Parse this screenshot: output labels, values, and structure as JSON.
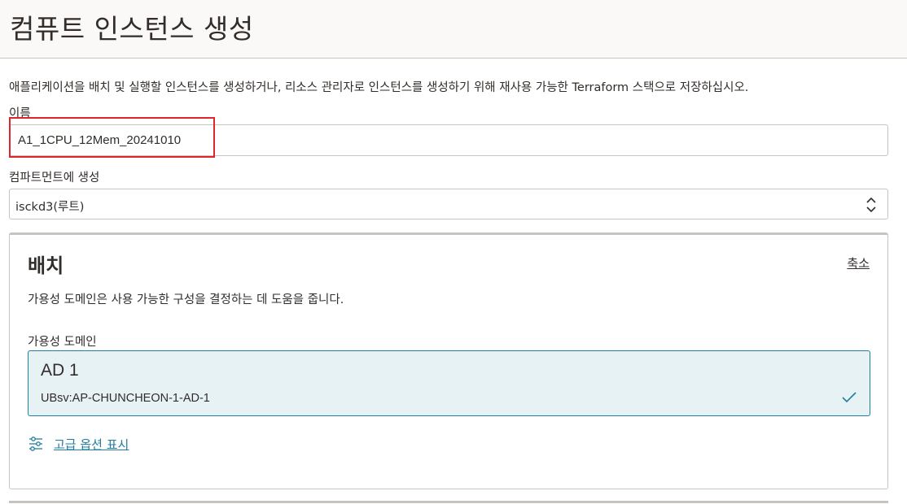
{
  "header": {
    "title": "컴퓨트 인스턴스 생성"
  },
  "description": "애플리케이션을 배치 및 실행할 인스턴스를 생성하거나, 리소스 관리자로 인스턴스를 생성하기 위해 재사용 가능한 Terraform 스택으로 저장하십시오.",
  "name_field": {
    "label": "이름",
    "value": "A1_1CPU_12Mem_20241010"
  },
  "compartment_field": {
    "label": "컴파트먼트에 생성",
    "value": "isckd3(루트)"
  },
  "placement": {
    "title": "배치",
    "collapse_label": "축소",
    "description": "가용성 도메인은 사용 가능한 구성을 결정하는 데 도움을 줍니다.",
    "ad_label": "가용성 도메인",
    "ad_options": [
      {
        "name": "AD 1",
        "id": "UBsv:AP-CHUNCHEON-1-AD-1",
        "selected": true
      }
    ],
    "advanced_toggle": "고급 옵션 표시"
  },
  "colors": {
    "accent": "#227e9e",
    "selected_bg": "#e7f2f5",
    "highlight": "#e0262c",
    "header_bg": "#fbf9f8"
  }
}
